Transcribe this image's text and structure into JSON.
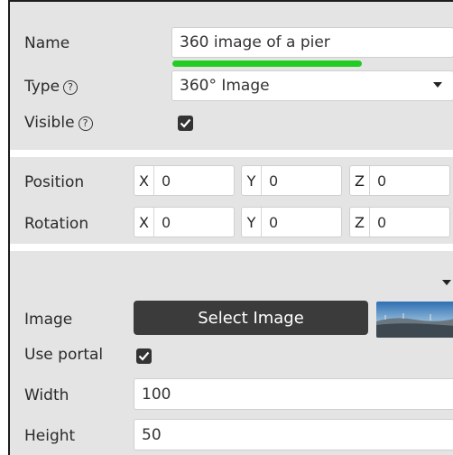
{
  "general": {
    "name_label": "Name",
    "name_value": "360 image of a pier",
    "type_label": "Type",
    "type_value": "360° Image",
    "visible_label": "Visible",
    "help_glyph": "?",
    "visible_checked": true
  },
  "transform": {
    "position_label": "Position",
    "rotation_label": "Rotation",
    "axes": [
      "X",
      "Y",
      "Z"
    ],
    "position": [
      "0",
      "0",
      "0"
    ],
    "rotation": [
      "0",
      "0",
      "0"
    ]
  },
  "media": {
    "image_label": "Image",
    "select_image_label": "Select Image",
    "use_portal_label": "Use portal",
    "use_portal_checked": true,
    "width_label": "Width",
    "width_value": "100",
    "height_label": "Height",
    "height_value": "50",
    "thumbnail_icon": "panorama-thumbnail"
  },
  "colors": {
    "panel_bg": "#e4e4e4",
    "accent_underline": "#22cc22",
    "button_bg": "#3b3b3b",
    "checkbox_bg": "#333333"
  }
}
